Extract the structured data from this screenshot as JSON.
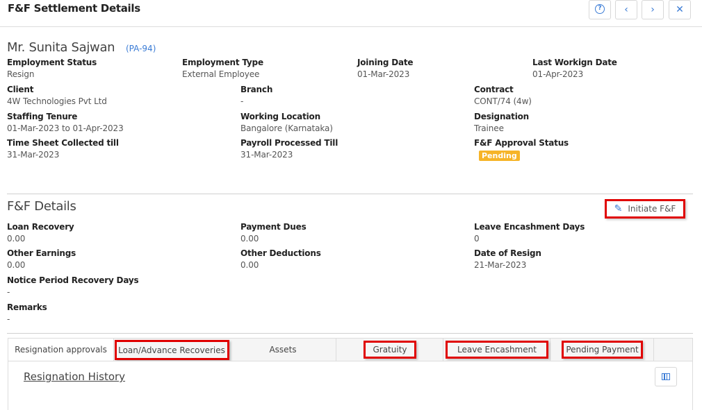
{
  "header": {
    "title": "F&F Settlement Details",
    "help_icon": "?",
    "prev_icon": "‹",
    "next_icon": "›",
    "close_icon": "✕"
  },
  "employee": {
    "name": "Mr. Sunita Sajwan",
    "code": "(PA-94)",
    "employment_status_label": "Employment Status",
    "employment_status": "Resign",
    "employment_type_label": "Employment Type",
    "employment_type": "External Employee",
    "joining_date_label": "Joining Date",
    "joining_date": "01-Mar-2023",
    "last_working_date_label": "Last Workign Date",
    "last_working_date": "01-Apr-2023",
    "client_label": "Client",
    "client": "4W Technologies Pvt Ltd",
    "branch_label": "Branch",
    "branch": "-",
    "contract_label": "Contract",
    "contract": "CONT/74 (4w)",
    "staffing_tenure_label": "Staffing Tenure",
    "staffing_tenure": "01-Mar-2023 to 01-Apr-2023",
    "working_location_label": "Working Location",
    "working_location": "Bangalore (Karnataka)",
    "designation_label": "Designation",
    "designation": "Trainee",
    "timesheet_label": "Time Sheet Collected till",
    "timesheet": "31-Mar-2023",
    "payroll_label": "Payroll Processed Till",
    "payroll": "31-Mar-2023",
    "approval_label": "F&F Approval Status",
    "approval_status": "Pending"
  },
  "ff_details": {
    "title": "F&F Details",
    "initiate_label": "Initiate F&F",
    "loan_recovery_label": "Loan Recovery",
    "loan_recovery": "0.00",
    "payment_dues_label": "Payment Dues",
    "payment_dues": "0.00",
    "leave_encashment_days_label": "Leave Encashment Days",
    "leave_encashment_days": "0",
    "other_earnings_label": "Other Earnings",
    "other_earnings": "0.00",
    "other_deductions_label": "Other Deductions",
    "other_deductions": "0.00",
    "date_of_resign_label": "Date of Resign",
    "date_of_resign": "21-Mar-2023",
    "notice_period_label": "Notice Period Recovery Days",
    "notice_period": "-",
    "remarks_label": "Remarks",
    "remarks": "-"
  },
  "tabs": [
    {
      "label": "Resignation approvals"
    },
    {
      "label": "Loan/Advance Recoveries"
    },
    {
      "label": "Assets"
    },
    {
      "label": "Gratuity"
    },
    {
      "label": "Leave Encashment"
    },
    {
      "label": "Pending Payment"
    }
  ],
  "tab_content": {
    "history_title": "Resignation History"
  },
  "colors": {
    "accent": "#3a7bd5",
    "pending_badge": "#f6b428",
    "highlight": "#e00000"
  }
}
